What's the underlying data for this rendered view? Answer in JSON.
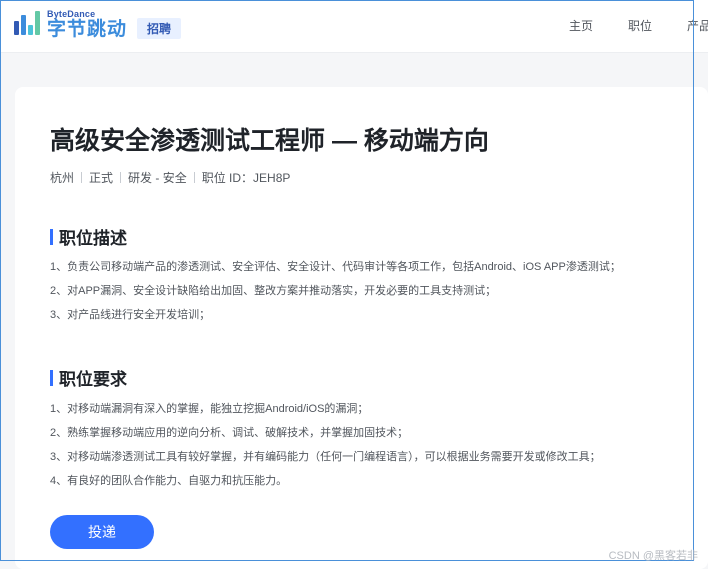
{
  "header": {
    "brand_en": "ByteDance",
    "brand_cn": "字节跳动",
    "tag": "招聘",
    "nav": [
      "主页",
      "职位",
      "产品"
    ]
  },
  "job": {
    "title": "高级安全渗透测试工程师 — 移动端方向",
    "meta": [
      "杭州",
      "正式",
      "研发 - 安全",
      "职位 ID：JEH8P"
    ]
  },
  "description": {
    "heading": "职位描述",
    "items": [
      "1、负责公司移动端产品的渗透测试、安全评估、安全设计、代码审计等各项工作，包括Android、iOS APP渗透测试；",
      "2、对APP漏洞、安全设计缺陷给出加固、整改方案并推动落实，开发必要的工具支持测试；",
      "3、对产品线进行安全开发培训；"
    ]
  },
  "requirements": {
    "heading": "职位要求",
    "items": [
      "1、对移动端漏洞有深入的掌握，能独立挖掘Android/iOS的漏洞；",
      "2、熟练掌握移动端应用的逆向分析、调试、破解技术，并掌握加固技术；",
      "3、对移动端渗透测试工具有较好掌握，并有编码能力（任何一门编程语言），可以根据业务需要开发或修改工具；",
      "4、有良好的团队合作能力、自驱力和抗压能力。"
    ]
  },
  "apply_label": "投递",
  "watermark": "CSDN @黑客若非",
  "colors": {
    "accent": "#3370ff",
    "logo": "#3c8cdc"
  }
}
